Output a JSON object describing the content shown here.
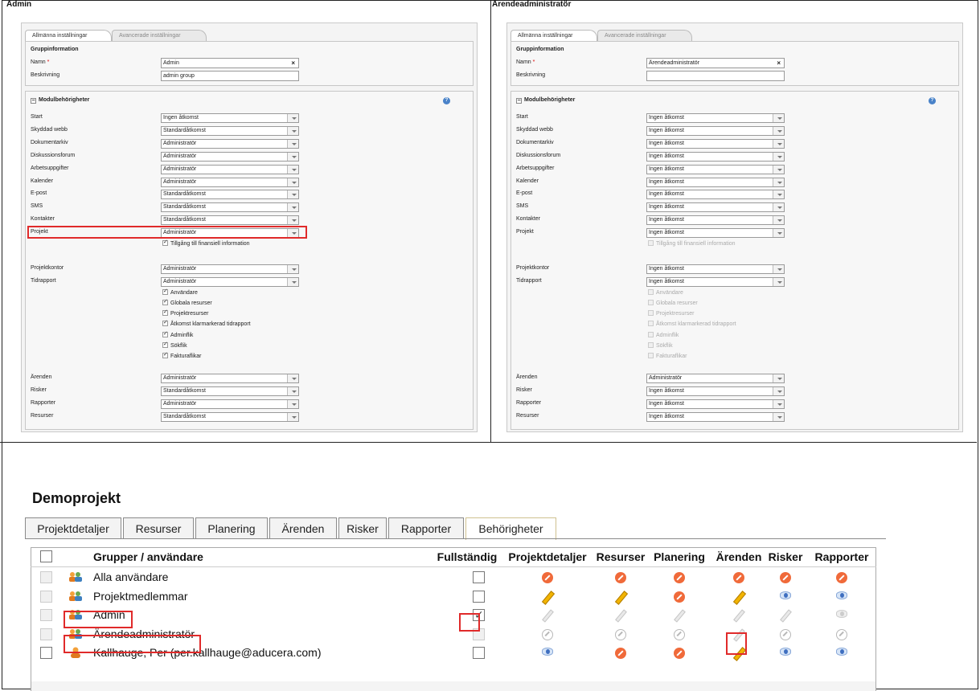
{
  "left_panel": {
    "caption": "Admin",
    "tabs": [
      "Allmänna inställningar",
      "Avancerade inställningar"
    ],
    "group_section_title": "Gruppinformation",
    "name_label": "Namn",
    "required_mark": "*",
    "name_value": "Admin",
    "clear_glyph": "×",
    "desc_label": "Beskrivning",
    "desc_value": "admin group",
    "module_section_title": "Modulbehörigheter",
    "help_glyph": "?",
    "modules": [
      {
        "label": "Start",
        "value": "Ingen åtkomst"
      },
      {
        "label": "Skyddad webb",
        "value": "Standardåtkomst"
      },
      {
        "label": "Dokumentarkiv",
        "value": "Administratör"
      },
      {
        "label": "Diskussionsforum",
        "value": "Administratör"
      },
      {
        "label": "Arbetsuppgifter",
        "value": "Administratör"
      },
      {
        "label": "Kalender",
        "value": "Administratör"
      },
      {
        "label": "E-post",
        "value": "Standardåtkomst"
      },
      {
        "label": "SMS",
        "value": "Standardåtkomst"
      },
      {
        "label": "Kontakter",
        "value": "Standardåtkomst"
      },
      {
        "label": "Projekt",
        "value": "Administratör"
      }
    ],
    "projekt_checkbox": "Tillgång till finansiell information",
    "modules2": [
      {
        "label": "Projektkontor",
        "value": "Administratör"
      },
      {
        "label": "Tidrapport",
        "value": "Administratör"
      }
    ],
    "tid_checks": [
      "Användare",
      "Globala resurser",
      "Projektresurser",
      "Åtkomst klarmarkerad tidrapport",
      "Adminflik",
      "Sökflik",
      "Fakturaflikar"
    ],
    "modules3": [
      {
        "label": "Ärenden",
        "value": "Administratör"
      },
      {
        "label": "Risker",
        "value": "Standardåtkomst"
      },
      {
        "label": "Rapporter",
        "value": "Administratör"
      },
      {
        "label": "Resurser",
        "value": "Standardåtkomst"
      }
    ]
  },
  "right_panel": {
    "caption": "Ärendeadministratör",
    "tabs": [
      "Allmänna inställningar",
      "Avancerade inställningar"
    ],
    "group_section_title": "Gruppinformation",
    "name_label": "Namn",
    "required_mark": "*",
    "name_value": "Ärendeadministratör",
    "clear_glyph": "×",
    "desc_label": "Beskrivning",
    "desc_value": "",
    "module_section_title": "Modulbehörigheter",
    "help_glyph": "?",
    "modules": [
      {
        "label": "Start",
        "value": "Ingen åtkomst"
      },
      {
        "label": "Skyddad webb",
        "value": "Ingen åtkomst"
      },
      {
        "label": "Dokumentarkiv",
        "value": "Ingen åtkomst"
      },
      {
        "label": "Diskussionsforum",
        "value": "Ingen åtkomst"
      },
      {
        "label": "Arbetsuppgifter",
        "value": "Ingen åtkomst"
      },
      {
        "label": "Kalender",
        "value": "Ingen åtkomst"
      },
      {
        "label": "E-post",
        "value": "Ingen åtkomst"
      },
      {
        "label": "SMS",
        "value": "Ingen åtkomst"
      },
      {
        "label": "Kontakter",
        "value": "Ingen åtkomst"
      },
      {
        "label": "Projekt",
        "value": "Ingen åtkomst"
      }
    ],
    "projekt_checkbox": "Tillgång till finansiell information",
    "modules2": [
      {
        "label": "Projektkontor",
        "value": "Ingen åtkomst"
      },
      {
        "label": "Tidrapport",
        "value": "Ingen åtkomst"
      }
    ],
    "tid_checks": [
      "Användare",
      "Globala resurser",
      "Projektresurser",
      "Åtkomst klarmarkerad tidrapport",
      "Adminflik",
      "Sökflik",
      "Fakturaflikar"
    ],
    "modules3": [
      {
        "label": "Ärenden",
        "value": "Administratör"
      },
      {
        "label": "Risker",
        "value": "Ingen åtkomst"
      },
      {
        "label": "Rapporter",
        "value": "Ingen åtkomst"
      },
      {
        "label": "Resurser",
        "value": "Ingen åtkomst"
      }
    ]
  },
  "project": {
    "title": "Demoprojekt",
    "tabs": [
      "Projektdetaljer",
      "Resurser",
      "Planering",
      "Ärenden",
      "Risker",
      "Rapporter",
      "Behörigheter"
    ],
    "active_tab": "Behörigheter",
    "columns": [
      "Grupper / användare",
      "Fullständig",
      "Projektdetaljer",
      "Resurser",
      "Planering",
      "Ärenden",
      "Risker",
      "Rapporter"
    ],
    "rows": [
      {
        "name": "Alla användare",
        "icon": "group-icon",
        "full": "unchecked",
        "perms": [
          "block",
          "block",
          "block",
          "block",
          "block",
          "block"
        ]
      },
      {
        "name": "Projektmedlemmar",
        "icon": "group-icon",
        "full": "unchecked",
        "perms": [
          "pen",
          "pen",
          "block",
          "pen",
          "eye",
          "eye"
        ]
      },
      {
        "name": "Admin",
        "icon": "group-icon",
        "full": "checked",
        "perms": [
          "pen-gray",
          "pen-gray",
          "pen-gray",
          "pen-gray",
          "pen-gray",
          "eye-gray"
        ]
      },
      {
        "name": "Ärendeadministratör",
        "icon": "group-icon",
        "full": "disabled",
        "perms": [
          "block-gray",
          "block-gray",
          "block-gray",
          "pen-gray",
          "block-gray",
          "block-gray"
        ]
      },
      {
        "name": "Kallhauge, Per (per.kallhauge@aducera.com)",
        "icon": "user-icon",
        "full": "unchecked",
        "perms": [
          "eye",
          "block",
          "block",
          "pen",
          "eye",
          "eye"
        ]
      }
    ],
    "colors": {
      "highlight": "#e02a2a",
      "block": "#f06a3a",
      "pen": "#f2b400",
      "eye": "#3f6fc0"
    }
  }
}
